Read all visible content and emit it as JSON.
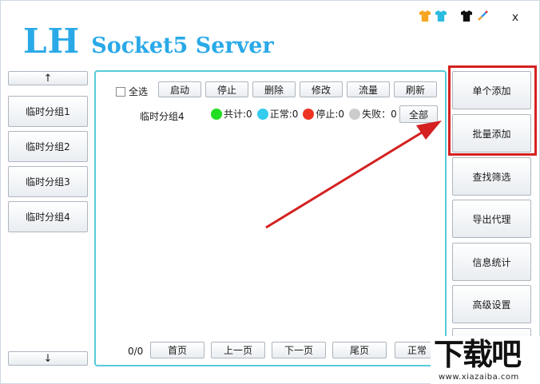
{
  "app": {
    "title_lh": "LH",
    "title_rest": "Socket5 Server",
    "close_label": "x",
    "accent_color": "#29a9e8",
    "skin_icons": [
      "shirt-orange-icon",
      "shirt-cyan-icon",
      "shirt-black-icon",
      "paint-brush-icon"
    ]
  },
  "left_groups": {
    "up_label": "↑",
    "down_label": "↓",
    "items": [
      "临时分组1",
      "临时分组2",
      "临时分组3",
      "临时分组4"
    ]
  },
  "main": {
    "select_all_label": "全选",
    "toolbar": [
      "启动",
      "停止",
      "删除",
      "修改",
      "流量",
      "刷新"
    ],
    "current_group": "临时分组4",
    "stats": {
      "total": "共计:0",
      "normal": "正常:0",
      "stopped": "停止:0",
      "failed": "失败：0"
    },
    "stat_colors": {
      "total": "#22dd22",
      "normal": "#33ccee",
      "stopped": "#ee3322",
      "failed": "#cccccc"
    },
    "all_label": "全部",
    "pager": {
      "count": "0/0",
      "first": "首页",
      "prev": "上一页",
      "next": "下一页",
      "last": "尾页",
      "mode": "正常"
    }
  },
  "right_actions": [
    "单个添加",
    "批量添加",
    "查找筛选",
    "导出代理",
    "信息统计",
    "高级设置"
  ],
  "watermark": {
    "text": "下载吧",
    "sub": "www.xiazaiba.com"
  }
}
